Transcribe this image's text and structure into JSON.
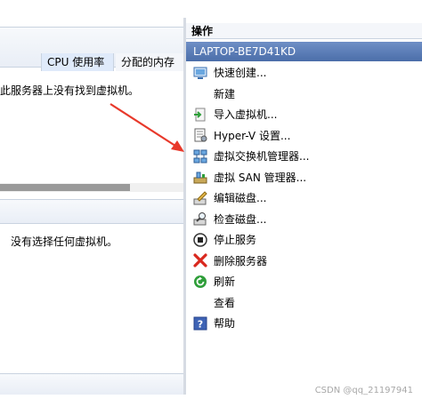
{
  "vm_list": {
    "columns": [
      "CPU 使用率",
      "分配的内存"
    ],
    "empty_message": "此服务器上没有找到虚拟机。"
  },
  "details": {
    "empty_message": "没有选择任何虚拟机。"
  },
  "actions_panel": {
    "title": "操作",
    "host_name": "LAPTOP-BE7D41KD",
    "items": [
      {
        "label": "快速创建...",
        "icon": "quick-create-icon"
      },
      {
        "label": "新建",
        "icon": "none"
      },
      {
        "label": "导入虚拟机...",
        "icon": "import-vm-icon"
      },
      {
        "label": "Hyper-V 设置...",
        "icon": "settings-document-icon"
      },
      {
        "label": "虚拟交换机管理器...",
        "icon": "virtual-switch-icon"
      },
      {
        "label": "虚拟 SAN 管理器...",
        "icon": "virtual-san-icon"
      },
      {
        "label": "编辑磁盘...",
        "icon": "edit-disk-icon"
      },
      {
        "label": "检查磁盘...",
        "icon": "inspect-disk-icon"
      },
      {
        "label": "停止服务",
        "icon": "stop-icon"
      },
      {
        "label": "删除服务器",
        "icon": "delete-x-icon"
      },
      {
        "label": "刷新",
        "icon": "refresh-icon"
      },
      {
        "label": "查看",
        "icon": "none"
      },
      {
        "label": "帮助",
        "icon": "help-icon"
      }
    ]
  },
  "watermark": "CSDN @qq_21197941",
  "colors": {
    "host_header": "#5a7db8",
    "annotation_arrow": "#e8392b",
    "delete_x": "#d9281e",
    "refresh": "#2f9e3a",
    "help": "#3e63b5"
  }
}
